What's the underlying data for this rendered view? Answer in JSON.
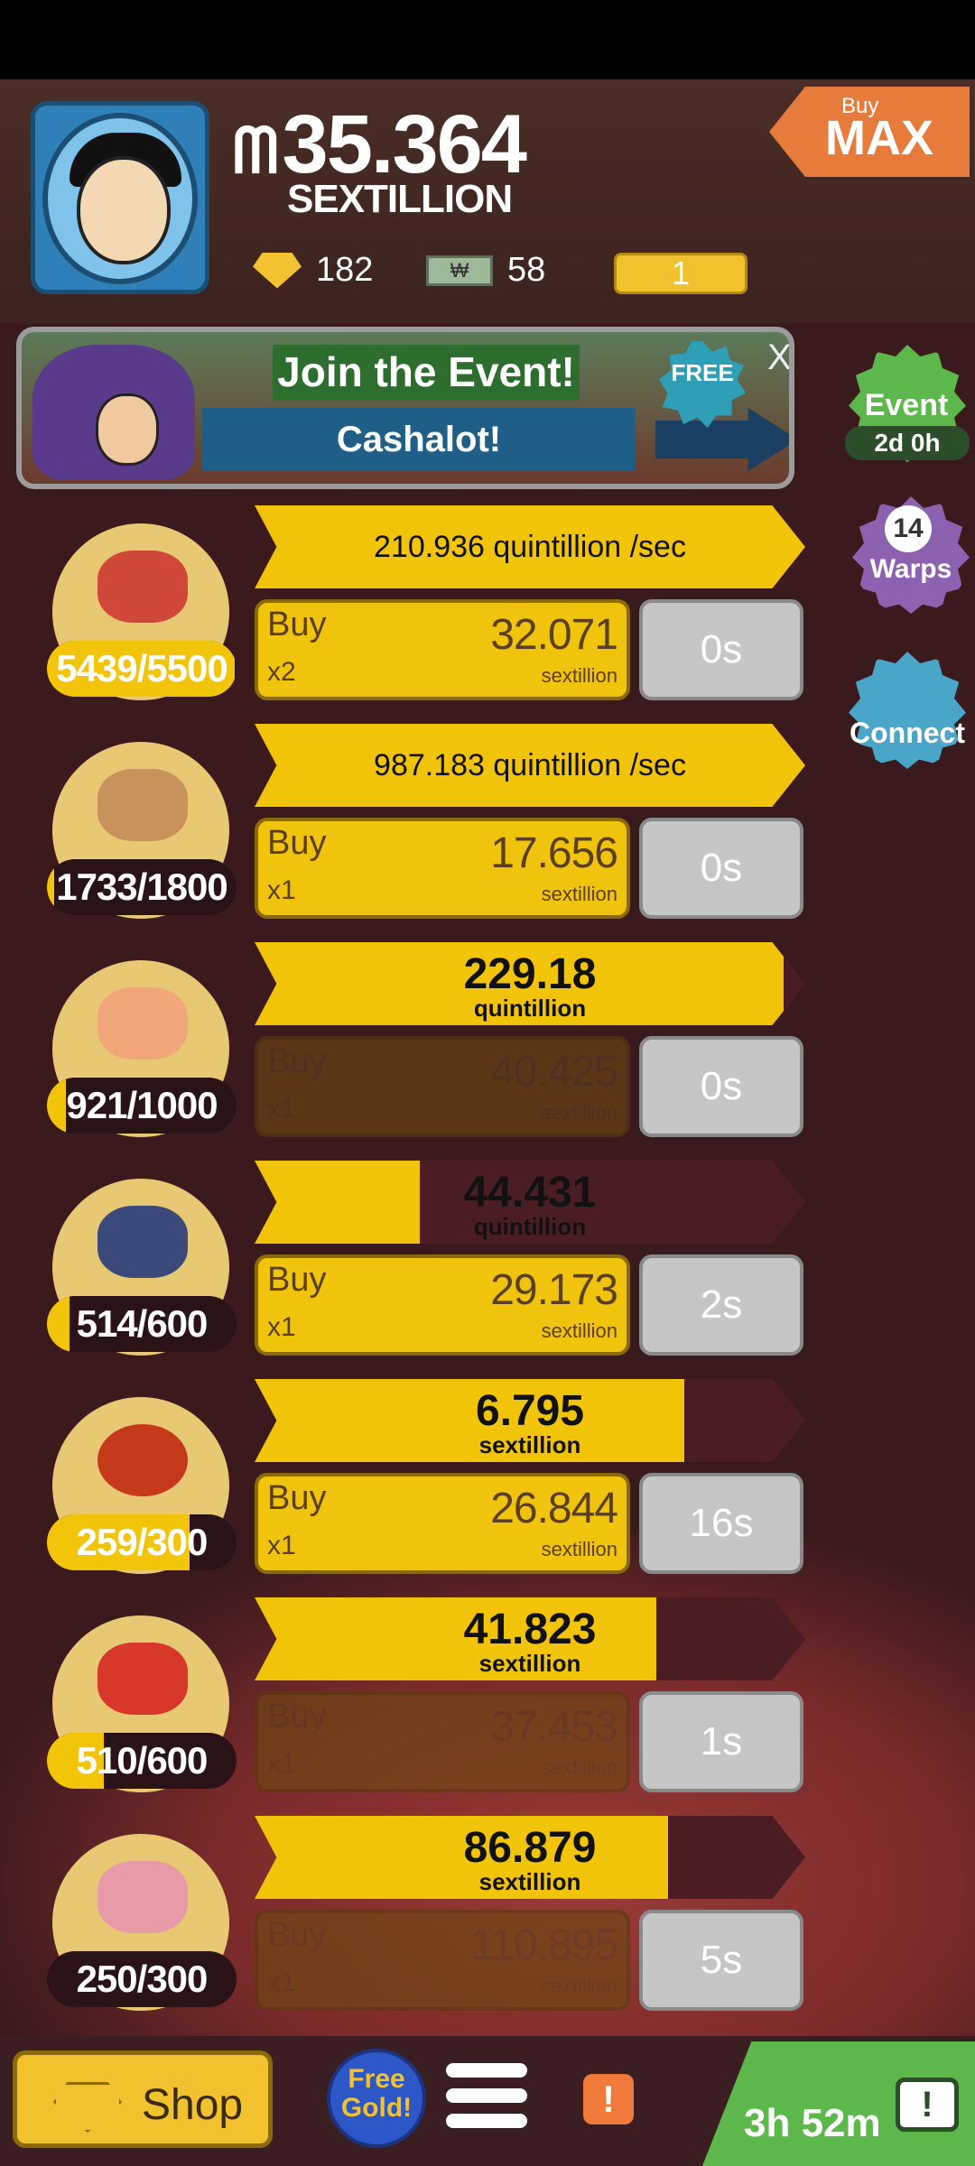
{
  "header": {
    "money_icon": "ᗰ",
    "money_value": "35.364",
    "money_unit": "SEXTILLION",
    "gold_count": "182",
    "megabucks_count": "58",
    "ticket_count": "1",
    "buy_max_top": "Buy",
    "buy_max_label": "MAX"
  },
  "event_banner": {
    "title": "Join the Event!",
    "subtitle": "Cashalot!",
    "free_label": "FREE",
    "close": "X"
  },
  "side": {
    "event_label": "Event",
    "event_time": "2d 0h",
    "warps_count": "14",
    "warps_label": "Warps",
    "connect_label": "Connect"
  },
  "businesses": [
    {
      "count": "5439/5500",
      "count_fraction": 0.99,
      "production": "210.936 quintillion /sec",
      "mode": "rate",
      "progress": 1.0,
      "buy_label": "Buy",
      "buy_mult": "x2",
      "price": "32.071",
      "price_unit": "sextillion",
      "timer": "0s",
      "enabled": true
    },
    {
      "count": "1733/1800",
      "count_fraction": 0.04,
      "production": "987.183 quintillion /sec",
      "mode": "rate",
      "progress": 1.0,
      "buy_label": "Buy",
      "buy_mult": "x1",
      "price": "17.656",
      "price_unit": "sextillion",
      "timer": "0s",
      "enabled": true
    },
    {
      "count": "921/1000",
      "count_fraction": 0.1,
      "production": "229.18",
      "production_unit": "quintillion",
      "mode": "amount",
      "progress": 0.96,
      "buy_label": "Buy",
      "buy_mult": "x1",
      "price": "40.425",
      "price_unit": "sextillion",
      "timer": "0s",
      "enabled": false
    },
    {
      "count": "514/600",
      "count_fraction": 0.12,
      "production": "44.431",
      "production_unit": "quintillion",
      "mode": "amount",
      "progress": 0.3,
      "buy_label": "Buy",
      "buy_mult": "x1",
      "price": "29.173",
      "price_unit": "sextillion",
      "timer": "2s",
      "enabled": true
    },
    {
      "count": "259/300",
      "count_fraction": 0.75,
      "production": "6.795",
      "production_unit": "sextillion",
      "mode": "amount",
      "progress": 0.78,
      "buy_label": "Buy",
      "buy_mult": "x1",
      "price": "26.844",
      "price_unit": "sextillion",
      "timer": "16s",
      "enabled": true
    },
    {
      "count": "510/600",
      "count_fraction": 0.3,
      "production": "41.823",
      "production_unit": "sextillion",
      "mode": "amount",
      "progress": 0.73,
      "buy_label": "Buy",
      "buy_mult": "x1",
      "price": "37.453",
      "price_unit": "sextillion",
      "timer": "1s",
      "enabled": false
    },
    {
      "count": "250/300",
      "count_fraction": 0.0,
      "production": "86.879",
      "production_unit": "sextillion",
      "mode": "amount",
      "progress": 0.75,
      "buy_label": "Buy",
      "buy_mult": "x1",
      "price": "110.895",
      "price_unit": "sextillion",
      "timer": "5s",
      "enabled": false
    }
  ],
  "bottom": {
    "shop_label": "Shop",
    "free_gold_label": "Free Gold!",
    "alert_label": "!",
    "timer_label": "3h 52m",
    "tv_label": "!"
  },
  "colors": {
    "gold": "#f1c40a",
    "background": "#3b1a1e",
    "green": "#5cb84a"
  }
}
